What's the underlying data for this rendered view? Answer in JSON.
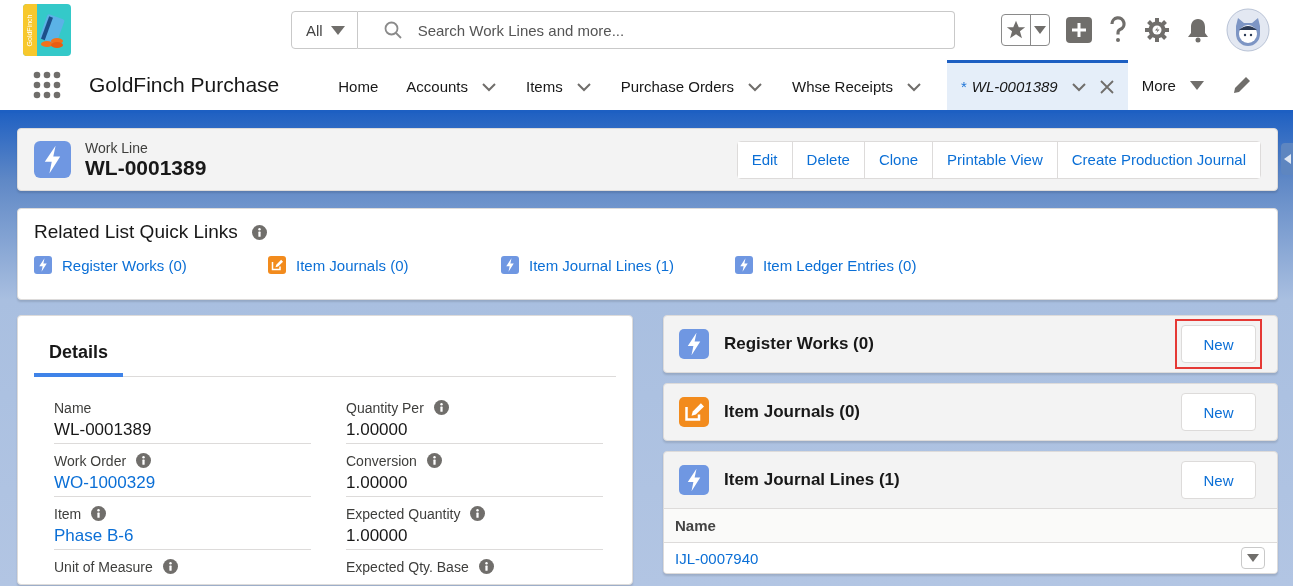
{
  "app": {
    "logo_text": "GoldFinch",
    "name": "GoldFinch Purchase"
  },
  "search": {
    "scope": "All",
    "placeholder": "Search Work Lines and more..."
  },
  "nav_items": [
    {
      "label": "Home",
      "menu": false,
      "closable": false,
      "selected": false
    },
    {
      "label": "Accounts",
      "menu": true,
      "closable": false,
      "selected": false
    },
    {
      "label": "Items",
      "menu": true,
      "closable": false,
      "selected": false
    },
    {
      "label": "Purchase Orders",
      "menu": true,
      "closable": false,
      "selected": false
    },
    {
      "label": "Whse Receipts",
      "menu": true,
      "closable": false,
      "selected": false
    },
    {
      "label": "WL-0001389",
      "prefix": "*",
      "menu": true,
      "closable": true,
      "selected": true
    }
  ],
  "more": {
    "label": "More"
  },
  "record": {
    "object_type": "Work Line",
    "name": "WL-0001389",
    "actions": [
      "Edit",
      "Delete",
      "Clone",
      "Printable View",
      "Create Production Journal"
    ]
  },
  "quick_links": {
    "title": "Related List Quick Links",
    "links": [
      {
        "label": "Register Works (0)",
        "kind": "bolt"
      },
      {
        "label": "Item Journals (0)",
        "kind": "journal"
      },
      {
        "label": "Item Journal Lines (1)",
        "kind": "bolt"
      },
      {
        "label": "Item Ledger Entries (0)",
        "kind": "bolt"
      }
    ]
  },
  "details": {
    "tab": "Details",
    "fields": [
      {
        "label": "Name",
        "info": false,
        "value": "WL-0001389",
        "link": false
      },
      {
        "label": "Quantity Per",
        "info": true,
        "value": "1.00000",
        "link": false
      },
      {
        "label": "Work Order",
        "info": true,
        "value": "WO-1000329",
        "link": true
      },
      {
        "label": "Conversion",
        "info": true,
        "value": "1.00000",
        "link": false
      },
      {
        "label": "Item",
        "info": true,
        "value": "Phase B-6",
        "link": true
      },
      {
        "label": "Expected Quantity",
        "info": true,
        "value": "1.00000",
        "link": false
      },
      {
        "label": "Unit of Measure",
        "info": true
      },
      {
        "label": "Expected Qty. Base",
        "info": true
      }
    ]
  },
  "related": [
    {
      "title": "Register Works (0)",
      "kind": "bolt",
      "button": "New",
      "highlighted": true
    },
    {
      "title": "Item Journals (0)",
      "kind": "journal",
      "button": "New",
      "highlighted": false
    },
    {
      "title": "Item Journal Lines (1)",
      "kind": "bolt",
      "button": "New",
      "highlighted": false,
      "table": {
        "columns": [
          "Name"
        ],
        "rows": [
          [
            "IJL-0007940"
          ]
        ]
      }
    }
  ]
}
